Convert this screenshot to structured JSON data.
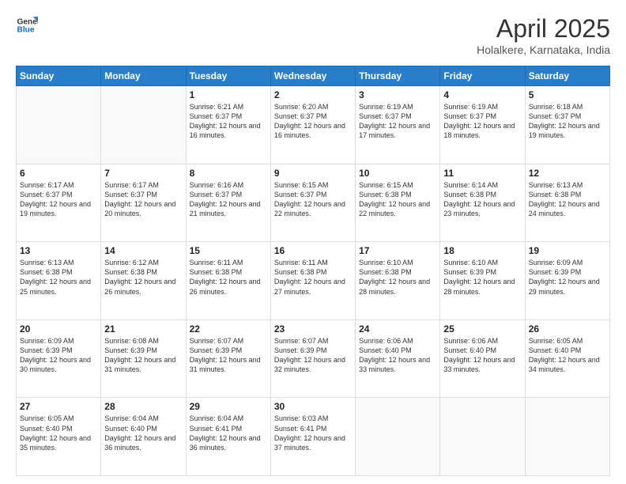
{
  "header": {
    "logo_general": "General",
    "logo_blue": "Blue",
    "month_title": "April 2025",
    "location": "Holalkere, Karnataka, India"
  },
  "days_of_week": [
    "Sunday",
    "Monday",
    "Tuesday",
    "Wednesday",
    "Thursday",
    "Friday",
    "Saturday"
  ],
  "weeks": [
    [
      {
        "day": "",
        "info": ""
      },
      {
        "day": "",
        "info": ""
      },
      {
        "day": "1",
        "info": "Sunrise: 6:21 AM\nSunset: 6:37 PM\nDaylight: 12 hours and 16 minutes."
      },
      {
        "day": "2",
        "info": "Sunrise: 6:20 AM\nSunset: 6:37 PM\nDaylight: 12 hours and 16 minutes."
      },
      {
        "day": "3",
        "info": "Sunrise: 6:19 AM\nSunset: 6:37 PM\nDaylight: 12 hours and 17 minutes."
      },
      {
        "day": "4",
        "info": "Sunrise: 6:19 AM\nSunset: 6:37 PM\nDaylight: 12 hours and 18 minutes."
      },
      {
        "day": "5",
        "info": "Sunrise: 6:18 AM\nSunset: 6:37 PM\nDaylight: 12 hours and 19 minutes."
      }
    ],
    [
      {
        "day": "6",
        "info": "Sunrise: 6:17 AM\nSunset: 6:37 PM\nDaylight: 12 hours and 19 minutes."
      },
      {
        "day": "7",
        "info": "Sunrise: 6:17 AM\nSunset: 6:37 PM\nDaylight: 12 hours and 20 minutes."
      },
      {
        "day": "8",
        "info": "Sunrise: 6:16 AM\nSunset: 6:37 PM\nDaylight: 12 hours and 21 minutes."
      },
      {
        "day": "9",
        "info": "Sunrise: 6:15 AM\nSunset: 6:37 PM\nDaylight: 12 hours and 22 minutes."
      },
      {
        "day": "10",
        "info": "Sunrise: 6:15 AM\nSunset: 6:38 PM\nDaylight: 12 hours and 22 minutes."
      },
      {
        "day": "11",
        "info": "Sunrise: 6:14 AM\nSunset: 6:38 PM\nDaylight: 12 hours and 23 minutes."
      },
      {
        "day": "12",
        "info": "Sunrise: 6:13 AM\nSunset: 6:38 PM\nDaylight: 12 hours and 24 minutes."
      }
    ],
    [
      {
        "day": "13",
        "info": "Sunrise: 6:13 AM\nSunset: 6:38 PM\nDaylight: 12 hours and 25 minutes."
      },
      {
        "day": "14",
        "info": "Sunrise: 6:12 AM\nSunset: 6:38 PM\nDaylight: 12 hours and 26 minutes."
      },
      {
        "day": "15",
        "info": "Sunrise: 6:11 AM\nSunset: 6:38 PM\nDaylight: 12 hours and 26 minutes."
      },
      {
        "day": "16",
        "info": "Sunrise: 6:11 AM\nSunset: 6:38 PM\nDaylight: 12 hours and 27 minutes."
      },
      {
        "day": "17",
        "info": "Sunrise: 6:10 AM\nSunset: 6:38 PM\nDaylight: 12 hours and 28 minutes."
      },
      {
        "day": "18",
        "info": "Sunrise: 6:10 AM\nSunset: 6:39 PM\nDaylight: 12 hours and 28 minutes."
      },
      {
        "day": "19",
        "info": "Sunrise: 6:09 AM\nSunset: 6:39 PM\nDaylight: 12 hours and 29 minutes."
      }
    ],
    [
      {
        "day": "20",
        "info": "Sunrise: 6:09 AM\nSunset: 6:39 PM\nDaylight: 12 hours and 30 minutes."
      },
      {
        "day": "21",
        "info": "Sunrise: 6:08 AM\nSunset: 6:39 PM\nDaylight: 12 hours and 31 minutes."
      },
      {
        "day": "22",
        "info": "Sunrise: 6:07 AM\nSunset: 6:39 PM\nDaylight: 12 hours and 31 minutes."
      },
      {
        "day": "23",
        "info": "Sunrise: 6:07 AM\nSunset: 6:39 PM\nDaylight: 12 hours and 32 minutes."
      },
      {
        "day": "24",
        "info": "Sunrise: 6:06 AM\nSunset: 6:40 PM\nDaylight: 12 hours and 33 minutes."
      },
      {
        "day": "25",
        "info": "Sunrise: 6:06 AM\nSunset: 6:40 PM\nDaylight: 12 hours and 33 minutes."
      },
      {
        "day": "26",
        "info": "Sunrise: 6:05 AM\nSunset: 6:40 PM\nDaylight: 12 hours and 34 minutes."
      }
    ],
    [
      {
        "day": "27",
        "info": "Sunrise: 6:05 AM\nSunset: 6:40 PM\nDaylight: 12 hours and 35 minutes."
      },
      {
        "day": "28",
        "info": "Sunrise: 6:04 AM\nSunset: 6:40 PM\nDaylight: 12 hours and 36 minutes."
      },
      {
        "day": "29",
        "info": "Sunrise: 6:04 AM\nSunset: 6:41 PM\nDaylight: 12 hours and 36 minutes."
      },
      {
        "day": "30",
        "info": "Sunrise: 6:03 AM\nSunset: 6:41 PM\nDaylight: 12 hours and 37 minutes."
      },
      {
        "day": "",
        "info": ""
      },
      {
        "day": "",
        "info": ""
      },
      {
        "day": "",
        "info": ""
      }
    ]
  ]
}
